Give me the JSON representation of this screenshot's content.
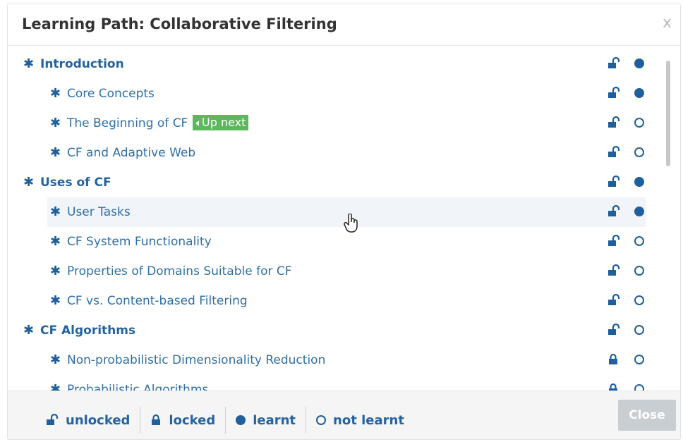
{
  "dialog": {
    "title": "Learning Path: Collaborative Filtering",
    "close_x": "x",
    "close_button": "Close"
  },
  "items": [
    {
      "label": "Introduction",
      "level": 0,
      "lock": "unlocked",
      "learnt": true
    },
    {
      "label": "Core Concepts",
      "level": 1,
      "lock": "unlocked",
      "learnt": true
    },
    {
      "label": "The Beginning of CF",
      "level": 1,
      "lock": "unlocked",
      "learnt": false,
      "badge": "Up next"
    },
    {
      "label": "CF and Adaptive Web",
      "level": 1,
      "lock": "unlocked",
      "learnt": false
    },
    {
      "label": "Uses of CF",
      "level": 0,
      "lock": "unlocked",
      "learnt": true
    },
    {
      "label": "User Tasks",
      "level": 1,
      "lock": "unlocked",
      "learnt": true,
      "hover": true
    },
    {
      "label": "CF System Functionality",
      "level": 1,
      "lock": "unlocked",
      "learnt": false
    },
    {
      "label": "Properties of Domains Suitable for CF",
      "level": 1,
      "lock": "unlocked",
      "learnt": false
    },
    {
      "label": "CF vs. Content-based Filtering",
      "level": 1,
      "lock": "unlocked",
      "learnt": false
    },
    {
      "label": "CF Algorithms",
      "level": 0,
      "lock": "unlocked",
      "learnt": false
    },
    {
      "label": "Non-probabilistic Dimensionality Reduction",
      "level": 1,
      "lock": "locked",
      "learnt": false
    },
    {
      "label": "Probabilistic Algorithms",
      "level": 1,
      "lock": "locked",
      "learnt": false
    }
  ],
  "legend": {
    "unlocked": "unlocked",
    "locked": "locked",
    "learnt": "learnt",
    "not_learnt": "not learnt"
  },
  "colors": {
    "accent": "#1e5f9c",
    "badge": "#5cb85c",
    "link": "#2f6fa7"
  }
}
